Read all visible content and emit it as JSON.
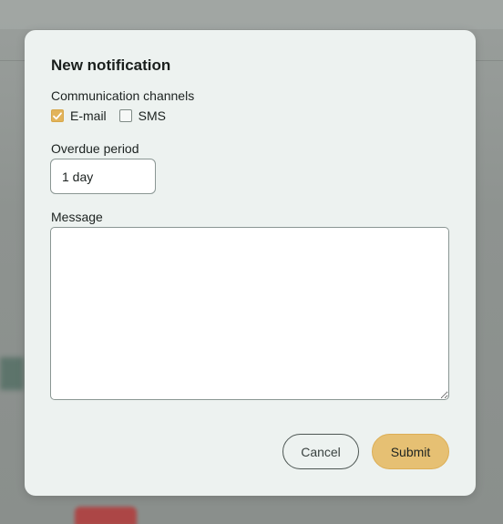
{
  "dialog": {
    "title": "New notification",
    "channels_label": "Communication channels",
    "channels": [
      {
        "label": "E-mail",
        "checked": true
      },
      {
        "label": "SMS",
        "checked": false
      }
    ],
    "overdue_label": "Overdue period",
    "overdue_value": "1 day",
    "message_label": "Message",
    "message_value": "",
    "cancel_label": "Cancel",
    "submit_label": "Submit"
  },
  "colors": {
    "accent": "#e6c073",
    "checkbox_checked": "#e2b35a",
    "modal_bg": "#edf2f0",
    "border": "#8a9693"
  },
  "icons": {
    "checkmark": "check-icon",
    "up": "chevron-up-icon",
    "down": "chevron-down-icon",
    "resize": "resize-handle-icon"
  }
}
